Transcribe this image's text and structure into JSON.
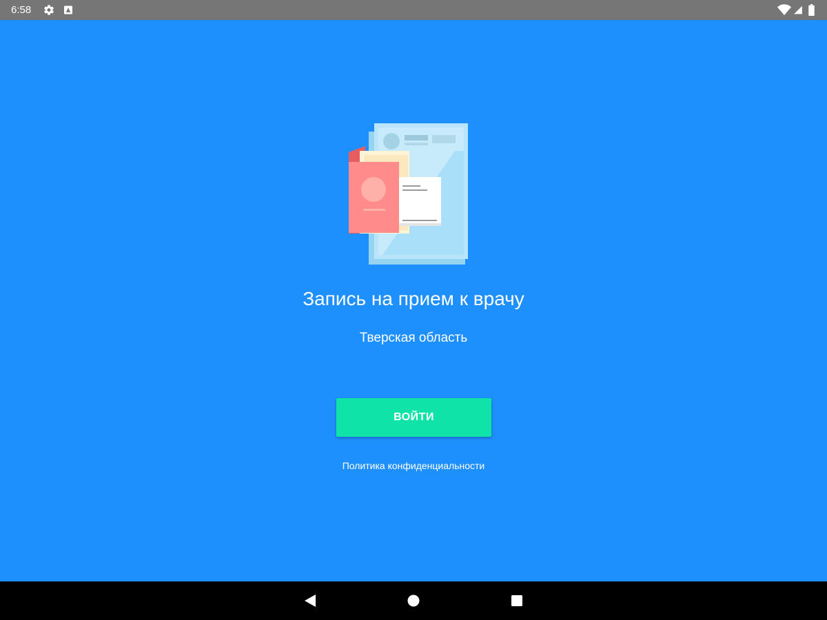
{
  "status_bar": {
    "time": "6:58",
    "icons": [
      "gear-icon",
      "notification-icon",
      "wifi-icon",
      "signal-icon",
      "battery-icon"
    ]
  },
  "main": {
    "illustration": "documents-illustration",
    "title": "Запись на прием к врачу",
    "region": "Тверская область",
    "login_button_label": "ВОЙТИ",
    "privacy_link": "Политика конфиденциальности"
  },
  "nav_bar": {
    "icons": [
      "back-icon",
      "home-icon",
      "recents-icon"
    ]
  },
  "colors": {
    "background": "#1e90fd",
    "button": "#0fe3a8",
    "status_bar": "#767676",
    "nav_bar": "#000000"
  }
}
